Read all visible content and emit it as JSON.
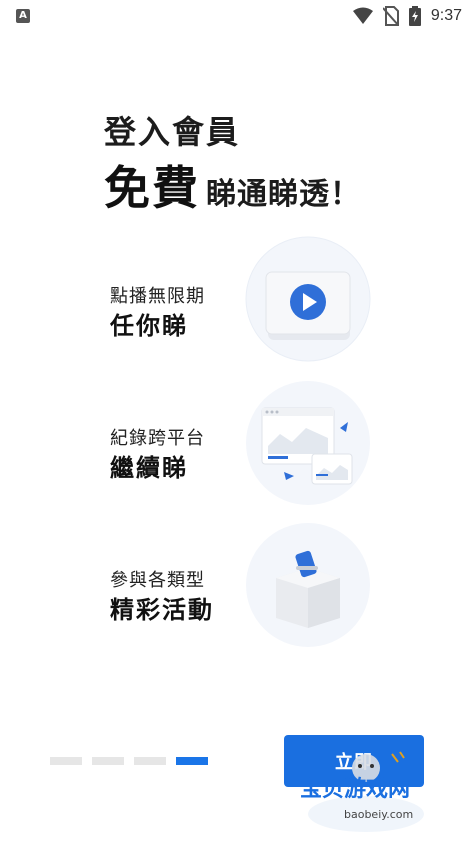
{
  "status_bar": {
    "time": "9:37",
    "app_icon_letter": "A"
  },
  "headline": {
    "line1": "登入會員",
    "free": "免費",
    "rest": "睇通睇透！"
  },
  "features": [
    {
      "small": "點播無限期",
      "big": "任你睇",
      "icon": "video-play-icon"
    },
    {
      "small": "紀錄跨平台",
      "big": "繼續睇",
      "icon": "cross-platform-icon"
    },
    {
      "small": "參與各類型",
      "big": "精彩活動",
      "icon": "ballot-box-icon"
    }
  ],
  "pager": {
    "total": 4,
    "active_index": 3
  },
  "cta": {
    "label": "立即"
  },
  "watermark": {
    "title": "宝贝游戏网",
    "url": "baobeiy.com"
  },
  "colors": {
    "accent": "#1a6fe0",
    "pager_inactive": "#e6e6e6"
  }
}
